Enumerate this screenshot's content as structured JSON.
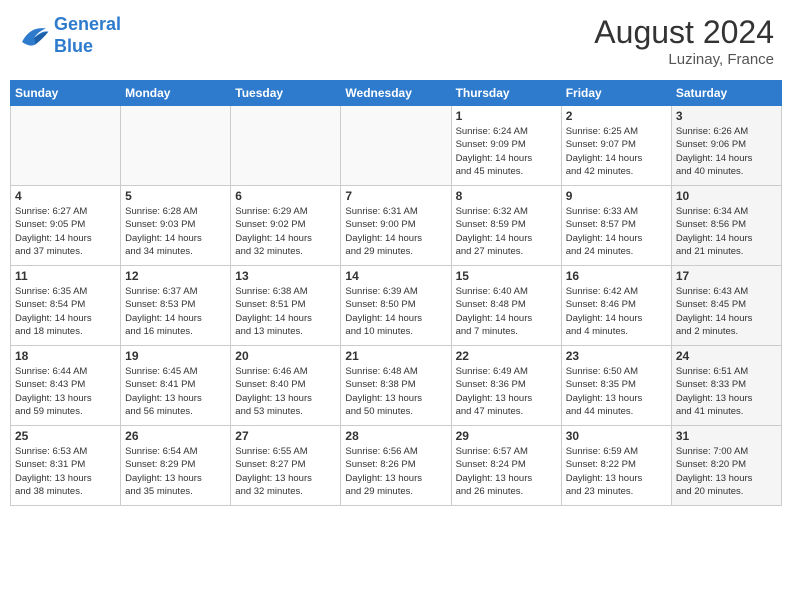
{
  "logo": {
    "line1": "General",
    "line2": "Blue"
  },
  "header": {
    "month_year": "August 2024",
    "location": "Luzinay, France"
  },
  "days_of_week": [
    "Sunday",
    "Monday",
    "Tuesday",
    "Wednesday",
    "Thursday",
    "Friday",
    "Saturday"
  ],
  "weeks": [
    [
      {
        "day": "",
        "info": ""
      },
      {
        "day": "",
        "info": ""
      },
      {
        "day": "",
        "info": ""
      },
      {
        "day": "",
        "info": ""
      },
      {
        "day": "1",
        "info": "Sunrise: 6:24 AM\nSunset: 9:09 PM\nDaylight: 14 hours\nand 45 minutes."
      },
      {
        "day": "2",
        "info": "Sunrise: 6:25 AM\nSunset: 9:07 PM\nDaylight: 14 hours\nand 42 minutes."
      },
      {
        "day": "3",
        "info": "Sunrise: 6:26 AM\nSunset: 9:06 PM\nDaylight: 14 hours\nand 40 minutes."
      }
    ],
    [
      {
        "day": "4",
        "info": "Sunrise: 6:27 AM\nSunset: 9:05 PM\nDaylight: 14 hours\nand 37 minutes."
      },
      {
        "day": "5",
        "info": "Sunrise: 6:28 AM\nSunset: 9:03 PM\nDaylight: 14 hours\nand 34 minutes."
      },
      {
        "day": "6",
        "info": "Sunrise: 6:29 AM\nSunset: 9:02 PM\nDaylight: 14 hours\nand 32 minutes."
      },
      {
        "day": "7",
        "info": "Sunrise: 6:31 AM\nSunset: 9:00 PM\nDaylight: 14 hours\nand 29 minutes."
      },
      {
        "day": "8",
        "info": "Sunrise: 6:32 AM\nSunset: 8:59 PM\nDaylight: 14 hours\nand 27 minutes."
      },
      {
        "day": "9",
        "info": "Sunrise: 6:33 AM\nSunset: 8:57 PM\nDaylight: 14 hours\nand 24 minutes."
      },
      {
        "day": "10",
        "info": "Sunrise: 6:34 AM\nSunset: 8:56 PM\nDaylight: 14 hours\nand 21 minutes."
      }
    ],
    [
      {
        "day": "11",
        "info": "Sunrise: 6:35 AM\nSunset: 8:54 PM\nDaylight: 14 hours\nand 18 minutes."
      },
      {
        "day": "12",
        "info": "Sunrise: 6:37 AM\nSunset: 8:53 PM\nDaylight: 14 hours\nand 16 minutes."
      },
      {
        "day": "13",
        "info": "Sunrise: 6:38 AM\nSunset: 8:51 PM\nDaylight: 14 hours\nand 13 minutes."
      },
      {
        "day": "14",
        "info": "Sunrise: 6:39 AM\nSunset: 8:50 PM\nDaylight: 14 hours\nand 10 minutes."
      },
      {
        "day": "15",
        "info": "Sunrise: 6:40 AM\nSunset: 8:48 PM\nDaylight: 14 hours\nand 7 minutes."
      },
      {
        "day": "16",
        "info": "Sunrise: 6:42 AM\nSunset: 8:46 PM\nDaylight: 14 hours\nand 4 minutes."
      },
      {
        "day": "17",
        "info": "Sunrise: 6:43 AM\nSunset: 8:45 PM\nDaylight: 14 hours\nand 2 minutes."
      }
    ],
    [
      {
        "day": "18",
        "info": "Sunrise: 6:44 AM\nSunset: 8:43 PM\nDaylight: 13 hours\nand 59 minutes."
      },
      {
        "day": "19",
        "info": "Sunrise: 6:45 AM\nSunset: 8:41 PM\nDaylight: 13 hours\nand 56 minutes."
      },
      {
        "day": "20",
        "info": "Sunrise: 6:46 AM\nSunset: 8:40 PM\nDaylight: 13 hours\nand 53 minutes."
      },
      {
        "day": "21",
        "info": "Sunrise: 6:48 AM\nSunset: 8:38 PM\nDaylight: 13 hours\nand 50 minutes."
      },
      {
        "day": "22",
        "info": "Sunrise: 6:49 AM\nSunset: 8:36 PM\nDaylight: 13 hours\nand 47 minutes."
      },
      {
        "day": "23",
        "info": "Sunrise: 6:50 AM\nSunset: 8:35 PM\nDaylight: 13 hours\nand 44 minutes."
      },
      {
        "day": "24",
        "info": "Sunrise: 6:51 AM\nSunset: 8:33 PM\nDaylight: 13 hours\nand 41 minutes."
      }
    ],
    [
      {
        "day": "25",
        "info": "Sunrise: 6:53 AM\nSunset: 8:31 PM\nDaylight: 13 hours\nand 38 minutes."
      },
      {
        "day": "26",
        "info": "Sunrise: 6:54 AM\nSunset: 8:29 PM\nDaylight: 13 hours\nand 35 minutes."
      },
      {
        "day": "27",
        "info": "Sunrise: 6:55 AM\nSunset: 8:27 PM\nDaylight: 13 hours\nand 32 minutes."
      },
      {
        "day": "28",
        "info": "Sunrise: 6:56 AM\nSunset: 8:26 PM\nDaylight: 13 hours\nand 29 minutes."
      },
      {
        "day": "29",
        "info": "Sunrise: 6:57 AM\nSunset: 8:24 PM\nDaylight: 13 hours\nand 26 minutes."
      },
      {
        "day": "30",
        "info": "Sunrise: 6:59 AM\nSunset: 8:22 PM\nDaylight: 13 hours\nand 23 minutes."
      },
      {
        "day": "31",
        "info": "Sunrise: 7:00 AM\nSunset: 8:20 PM\nDaylight: 13 hours\nand 20 minutes."
      }
    ]
  ]
}
